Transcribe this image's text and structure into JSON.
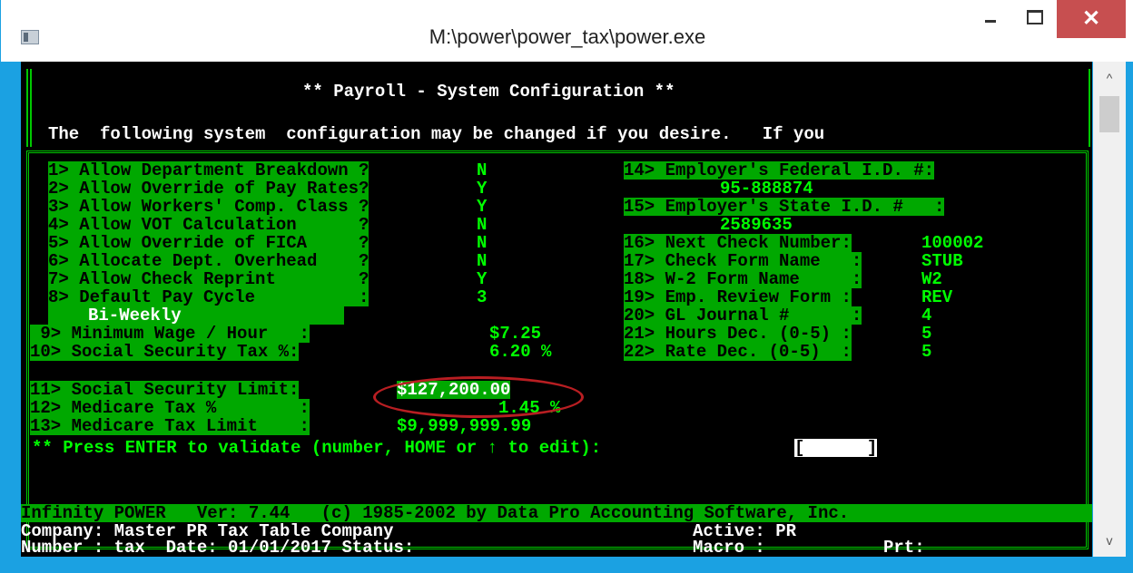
{
  "window": {
    "title": "M:\\power\\power_tax\\power.exe",
    "min": "_",
    "close": "✕"
  },
  "header": {
    "title": "** Payroll - System Configuration **",
    "subtitle": "The  following system  configuration may be changed if you desire.   If you"
  },
  "left_options": [
    {
      "label": "1> Allow Department Breakdown ?",
      "value": "N"
    },
    {
      "label": "2> Allow Override of Pay Rates?",
      "value": "Y"
    },
    {
      "label": "3> Allow Workers' Comp. Class ?",
      "value": "Y"
    },
    {
      "label": "4> Allow VOT Calculation      ?",
      "value": "N"
    },
    {
      "label": "5> Allow Override of FICA     ?",
      "value": "N"
    },
    {
      "label": "6> Allocate Dept. Overhead    ?",
      "value": "N"
    },
    {
      "label": "7> Allow Check Reprint        ?",
      "value": "Y"
    },
    {
      "label": "8> Default Pay Cycle          :",
      "value": "3"
    }
  ],
  "pay_cycle": "Bi-Weekly",
  "money_options": [
    {
      "label": " 9> Minimum Wage / Hour   :",
      "value": "$7.25"
    },
    {
      "label": "10> Social Security Tax %:",
      "value": "6.20 %"
    },
    {
      "label": "11> Social Security Limit:",
      "value": "$127,200.00"
    },
    {
      "label": "12> Medicare Tax %        :",
      "value": "1.45 %"
    },
    {
      "label": "13> Medicare Tax Limit    :",
      "value": "$9,999,999.99"
    }
  ],
  "employer": {
    "federal_label": "14> Employer's Federal I.D. #:",
    "federal_value": "95-888874",
    "state_label": "15> Employer's State I.D. #   :",
    "state_value": "2589635"
  },
  "right_options": [
    {
      "label": "16> Next Check Number:",
      "value": "100002"
    },
    {
      "label": "17> Check Form Name   :",
      "value": "STUB"
    },
    {
      "label": "18> W-2 Form Name     :",
      "value": "W2"
    },
    {
      "label": "19> Emp. Review Form :",
      "value": "REV"
    },
    {
      "label": "20> GL Journal #      :",
      "value": "4"
    },
    {
      "label": "21> Hours Dec. (0-5) :",
      "value": "5"
    },
    {
      "label": "22> Rate Dec. (0-5)  :",
      "value": "5"
    }
  ],
  "prompt": {
    "text": "** Press ENTER to validate (number, HOME or ↑ to edit):",
    "field": "[      ]"
  },
  "status": {
    "banner": "Infinity POWER   Ver: 7.44   (c) 1985-2002 by Data Pro Accounting Software, Inc.",
    "company": "Company: Master PR Tax Table Company",
    "active": "Active: PR",
    "number_line": "Number : tax  Date: 01/01/2017 Status:",
    "macro": "Macro :",
    "prt": "Prt:"
  },
  "scrollbar": {
    "up": "^",
    "down": "v"
  },
  "colors": {
    "console_bg": "#000000",
    "green": "#00ff00",
    "highlight": "#00a800",
    "annotation": "#b81e22",
    "window_border": "#1ba1e2"
  }
}
